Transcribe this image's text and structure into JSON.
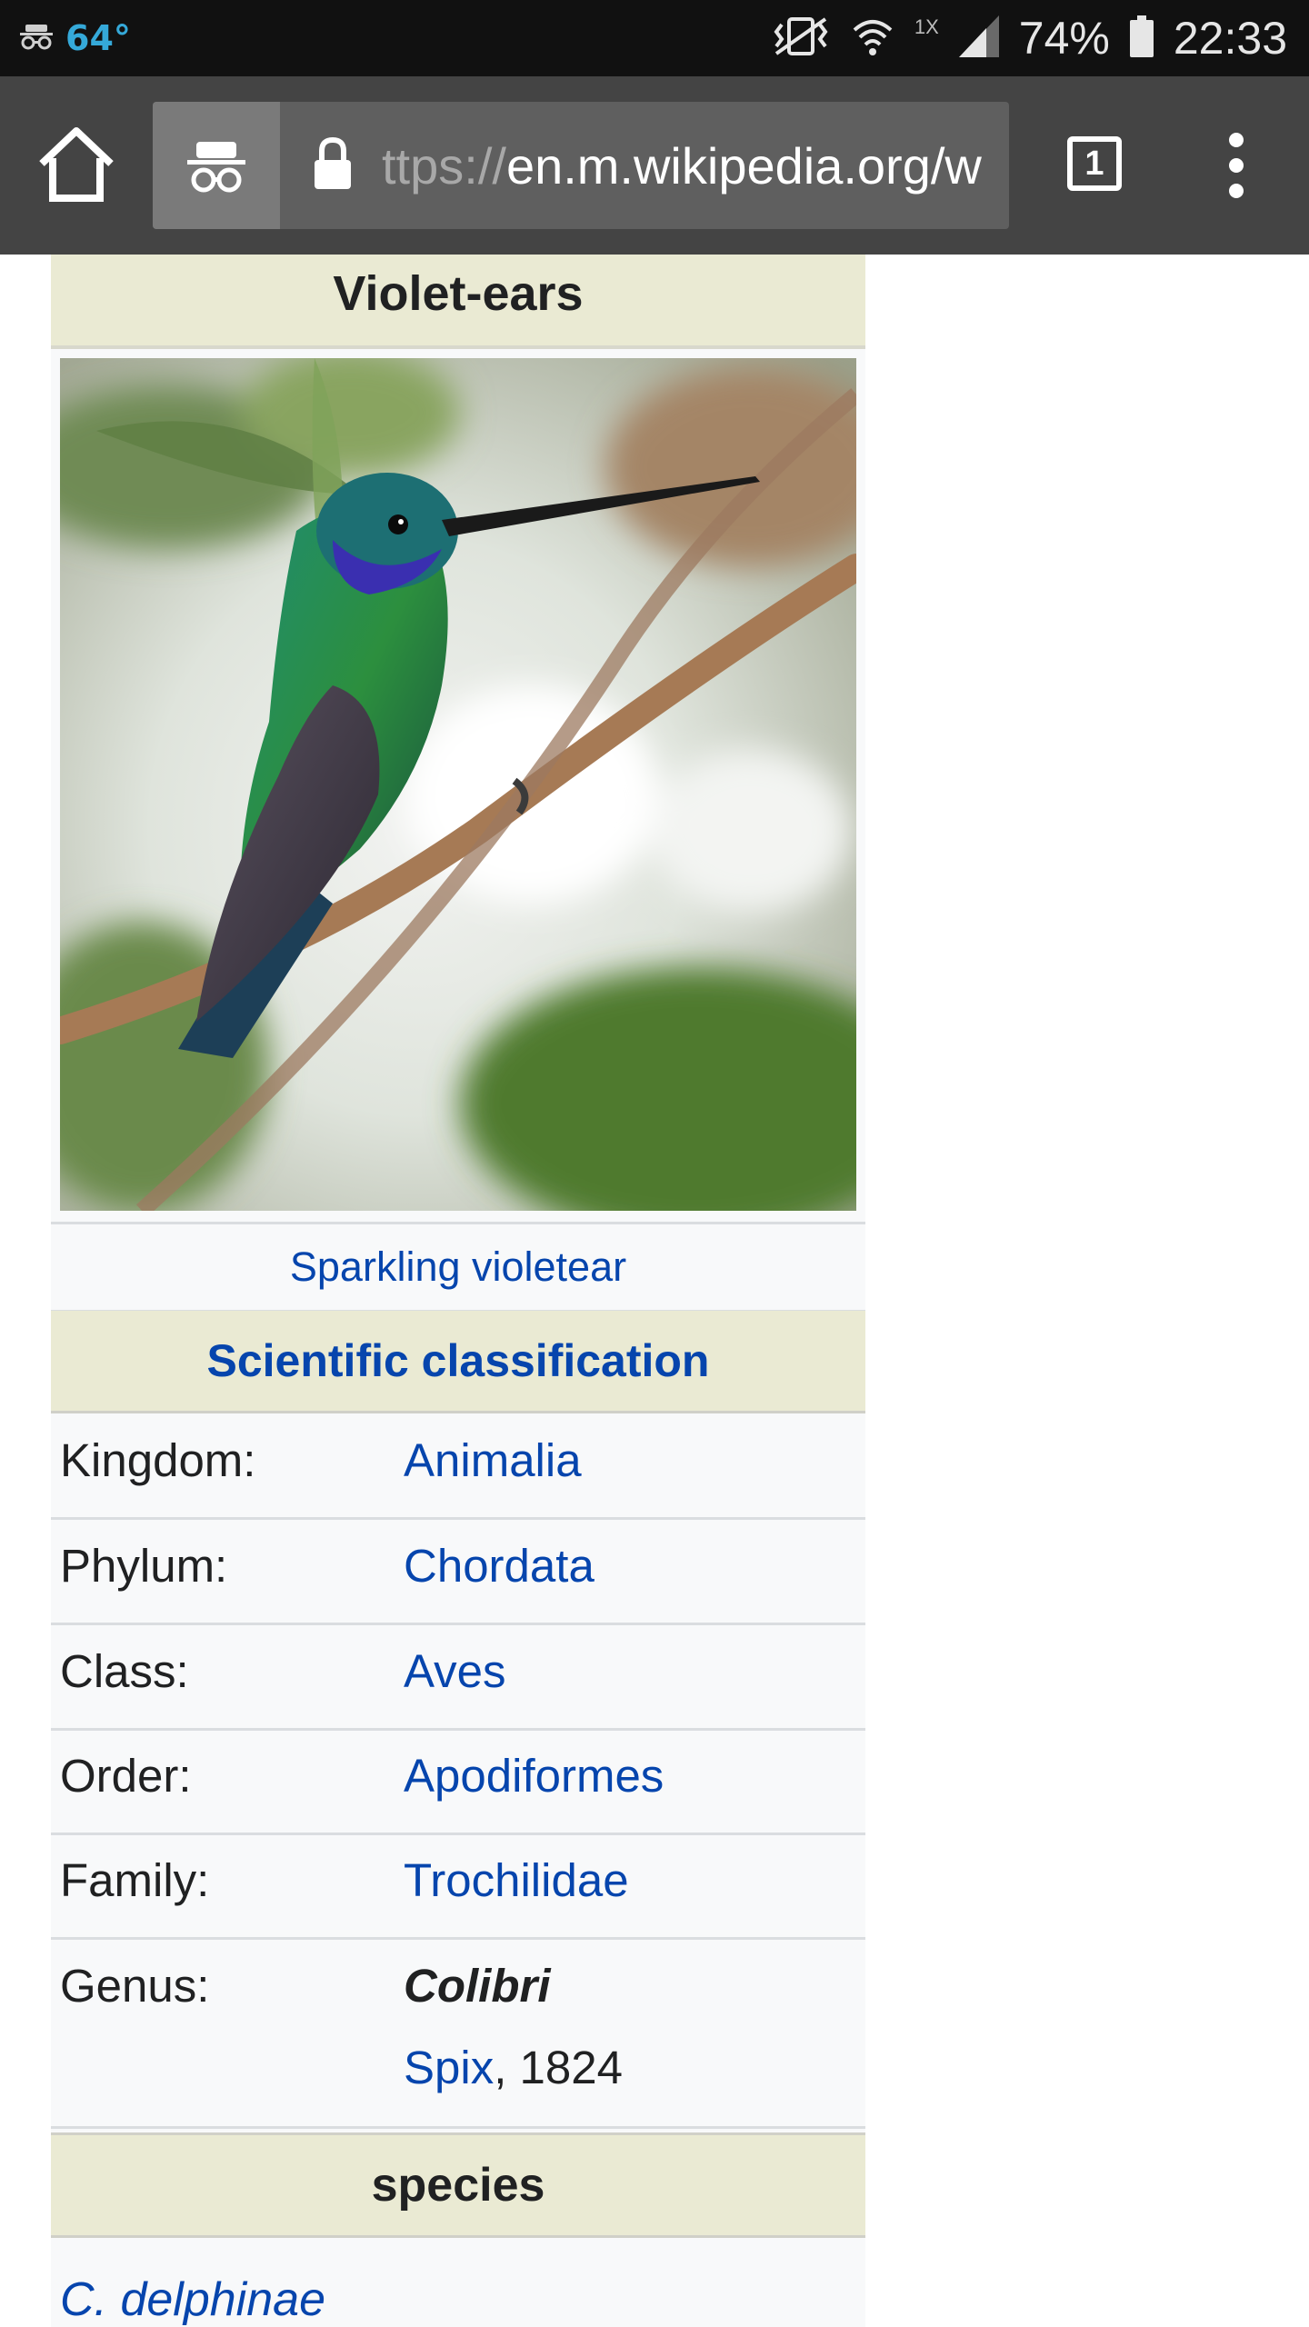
{
  "status_bar": {
    "incognito_icon": "incognito-icon",
    "temperature": "64°",
    "icons": [
      "vibrate-icon",
      "wifi-icon",
      "signal-icon"
    ],
    "network_type": "1X",
    "battery_percent": "74%",
    "time": "22:33"
  },
  "browser": {
    "url_scheme": "ttps://",
    "url_host": "en.m.wikipedia.org/w",
    "tab_count": "1",
    "colors": {
      "toolbar": "#444444",
      "url_box": "#5f5f5f"
    }
  },
  "infobox": {
    "title": "Violet-ears",
    "image_caption": "Sparkling violetear",
    "sci_header": "Scientific classification",
    "rows": [
      {
        "key": "Kingdom:",
        "value": "Animalia"
      },
      {
        "key": "Phylum:",
        "value": "Chordata"
      },
      {
        "key": "Class:",
        "value": "Aves"
      },
      {
        "key": "Order:",
        "value": "Apodiformes"
      },
      {
        "key": "Family:",
        "value": "Trochilidae"
      }
    ],
    "genus": {
      "key": "Genus:",
      "name": "Colibri",
      "authority_link": "Spix",
      "authority_year": ", 1824"
    },
    "species_header": "species",
    "first_species": "C. delphinae",
    "colors": {
      "header_bg": "#eaead3",
      "link": "#0645ad",
      "body_bg": "#f8f9fa"
    }
  }
}
